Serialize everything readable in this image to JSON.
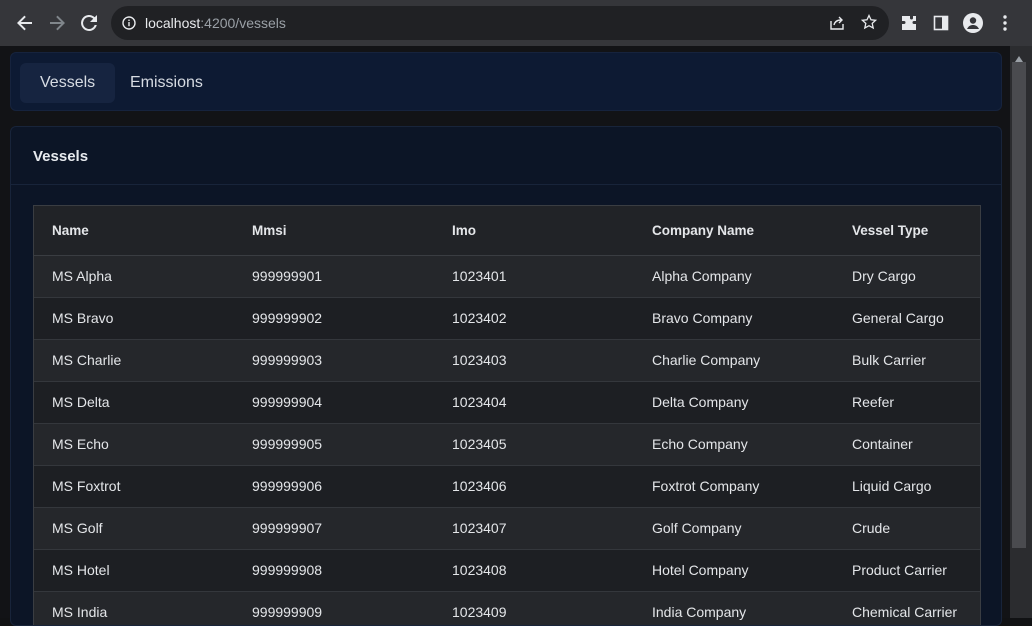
{
  "browser": {
    "url_host": "localhost",
    "url_path": ":4200/vessels"
  },
  "tabs": [
    {
      "label": "Vessels",
      "active": true
    },
    {
      "label": "Emissions",
      "active": false
    }
  ],
  "card": {
    "title": "Vessels"
  },
  "table": {
    "columns": [
      "Name",
      "Mmsi",
      "Imo",
      "Company Name",
      "Vessel Type"
    ],
    "rows": [
      [
        "MS Alpha",
        "999999901",
        "1023401",
        "Alpha Company",
        "Dry Cargo"
      ],
      [
        "MS Bravo",
        "999999902",
        "1023402",
        "Bravo Company",
        "General Cargo"
      ],
      [
        "MS Charlie",
        "999999903",
        "1023403",
        "Charlie Company",
        "Bulk Carrier"
      ],
      [
        "MS Delta",
        "999999904",
        "1023404",
        "Delta Company",
        "Reefer"
      ],
      [
        "MS Echo",
        "999999905",
        "1023405",
        "Echo Company",
        "Container"
      ],
      [
        "MS Foxtrot",
        "999999906",
        "1023406",
        "Foxtrot Company",
        "Liquid Cargo"
      ],
      [
        "MS Golf",
        "999999907",
        "1023407",
        "Golf Company",
        "Crude"
      ],
      [
        "MS Hotel",
        "999999908",
        "1023408",
        "Hotel Company",
        "Product Carrier"
      ],
      [
        "MS India",
        "999999909",
        "1023409",
        "India Company",
        "Chemical Carrier"
      ]
    ]
  },
  "colors": {
    "tabs_bg": "#0d1a33",
    "active_tab_bg": "#162440",
    "card_bg": "#0c1526",
    "table_bg": "#212327"
  }
}
